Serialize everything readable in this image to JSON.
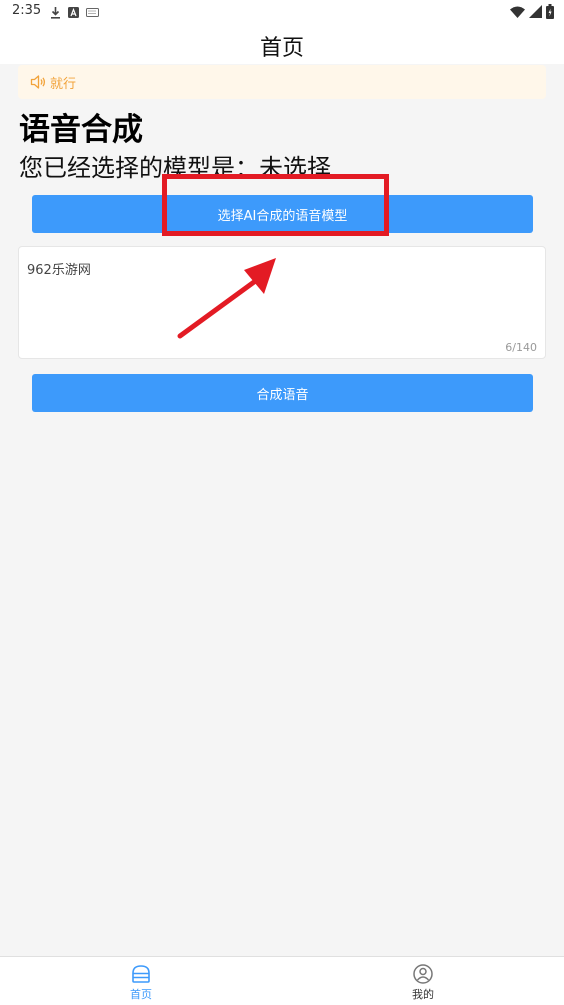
{
  "status_bar": {
    "time": "2:35",
    "left_icons": [
      "download-icon",
      "a-app-icon",
      "keyboard-icon"
    ],
    "right_icons": [
      "wifi-icon",
      "signal-icon",
      "battery-icon"
    ]
  },
  "header": {
    "title": "首页"
  },
  "notice": {
    "icon": "speaker-icon",
    "text": "就行",
    "color": "#f2a33a"
  },
  "section": {
    "title": "语音合成",
    "model_line": "您已经选择的模型是：未选择"
  },
  "buttons": {
    "select_model": "选择AI合成的语音模型",
    "synthesize": "合成语音",
    "color": "#3d9afb"
  },
  "text_input": {
    "value": "962乐游网",
    "count": "6/140"
  },
  "annotation": {
    "color": "#e31b24"
  },
  "tabbar": {
    "items": [
      {
        "label": "首页",
        "icon": "home-icon",
        "active": true
      },
      {
        "label": "我的",
        "icon": "profile-icon",
        "active": false
      }
    ],
    "active_color": "#3d9afb"
  }
}
